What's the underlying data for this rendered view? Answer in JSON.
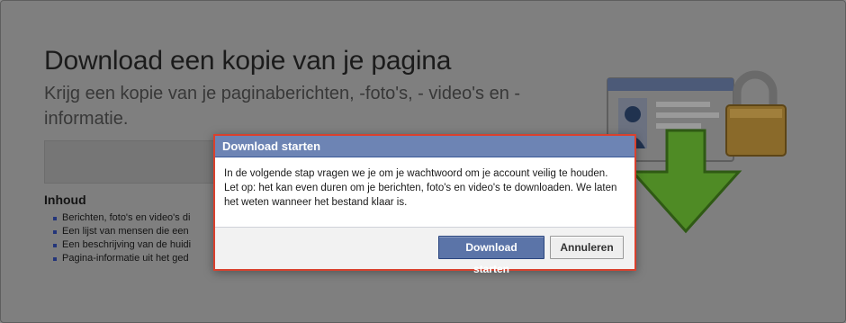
{
  "page": {
    "title": "Download een kopie van je pagina",
    "subtitle": "Krijg een kopie van je paginaberichten, -foto's, - video's en -informatie.",
    "contents_heading": "Inhoud",
    "contents_items": [
      "Berichten, foto's en video's di",
      "Een lijst van mensen die een",
      "Een beschrijving van de huidi",
      "Pagina-informatie uit het ged"
    ]
  },
  "dialog": {
    "title": "Download starten",
    "body": "In de volgende stap vragen we je om je wachtwoord om je account veilig te houden. Let op: het kan even duren om je berichten, foto's en video's te downloaden. We laten het weten wanneer het bestand klaar is.",
    "primary_label": "Download starten",
    "cancel_label": "Annuleren"
  },
  "colors": {
    "dialog_header": "#6d84b4",
    "dialog_border": "#d9412e",
    "primary_button": "#5b74a8",
    "download_arrow": "#4f8b25"
  }
}
